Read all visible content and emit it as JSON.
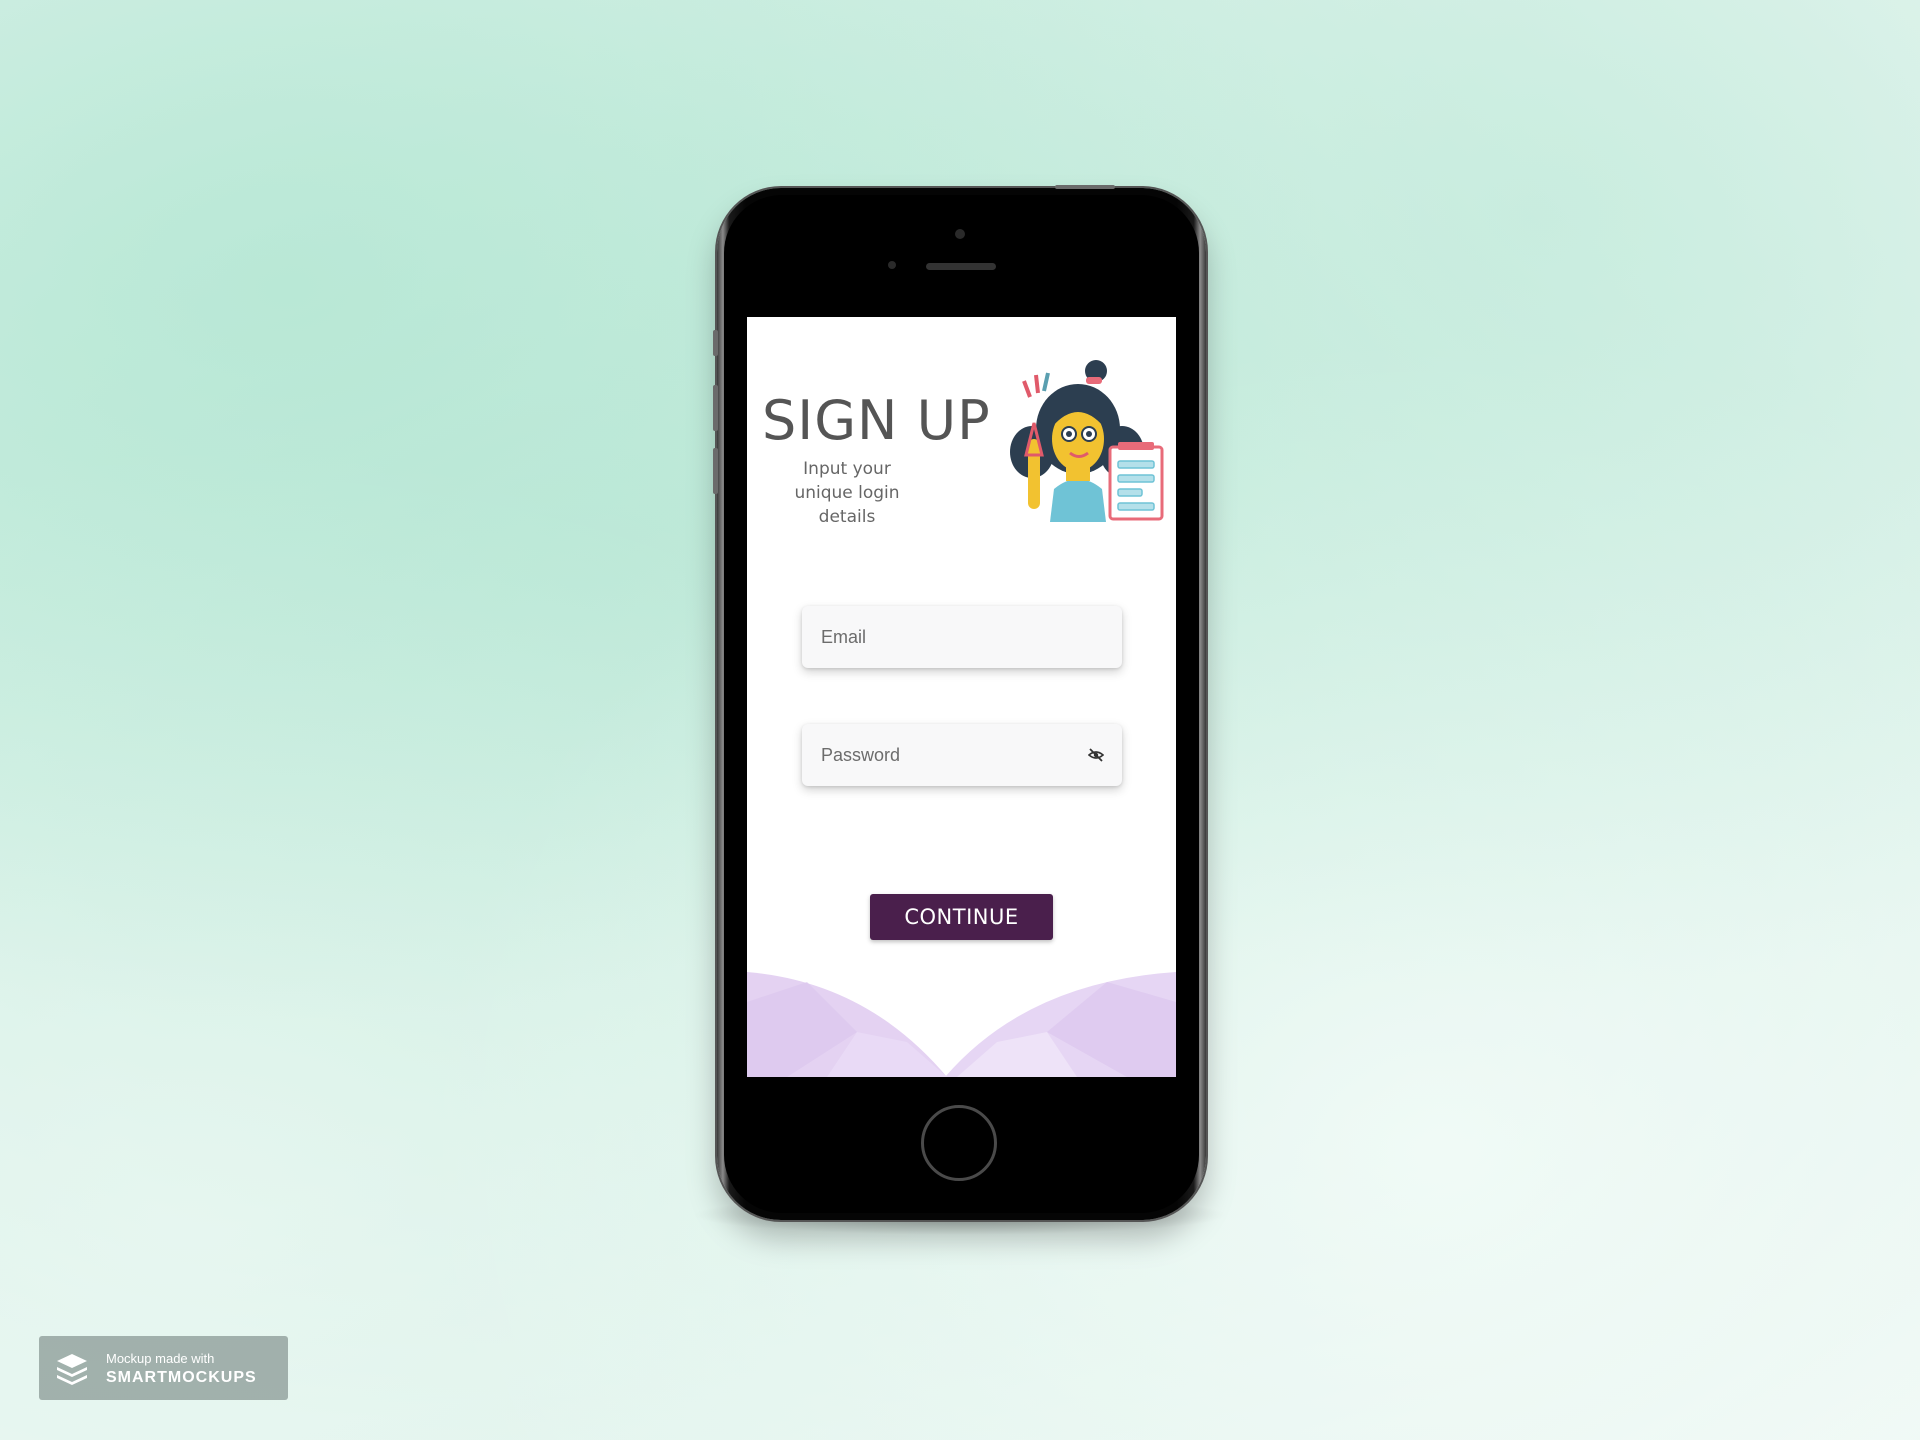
{
  "signup": {
    "title": "SIGN UP",
    "subtitle": "Input your unique login details",
    "email_placeholder": "Email",
    "password_placeholder": "Password",
    "continue_label": "CONTINUE"
  },
  "badge": {
    "line1": "Mockup made with",
    "line2": "SMARTMOCKUPS"
  },
  "icons": {
    "password_toggle": "eye-slash-icon",
    "badge_logo": "layers-icon"
  },
  "colors": {
    "accent": "#4a1f4c",
    "title_text": "#555555",
    "background": "#cdeee1",
    "bottom_shape": "#e4d2f2"
  }
}
